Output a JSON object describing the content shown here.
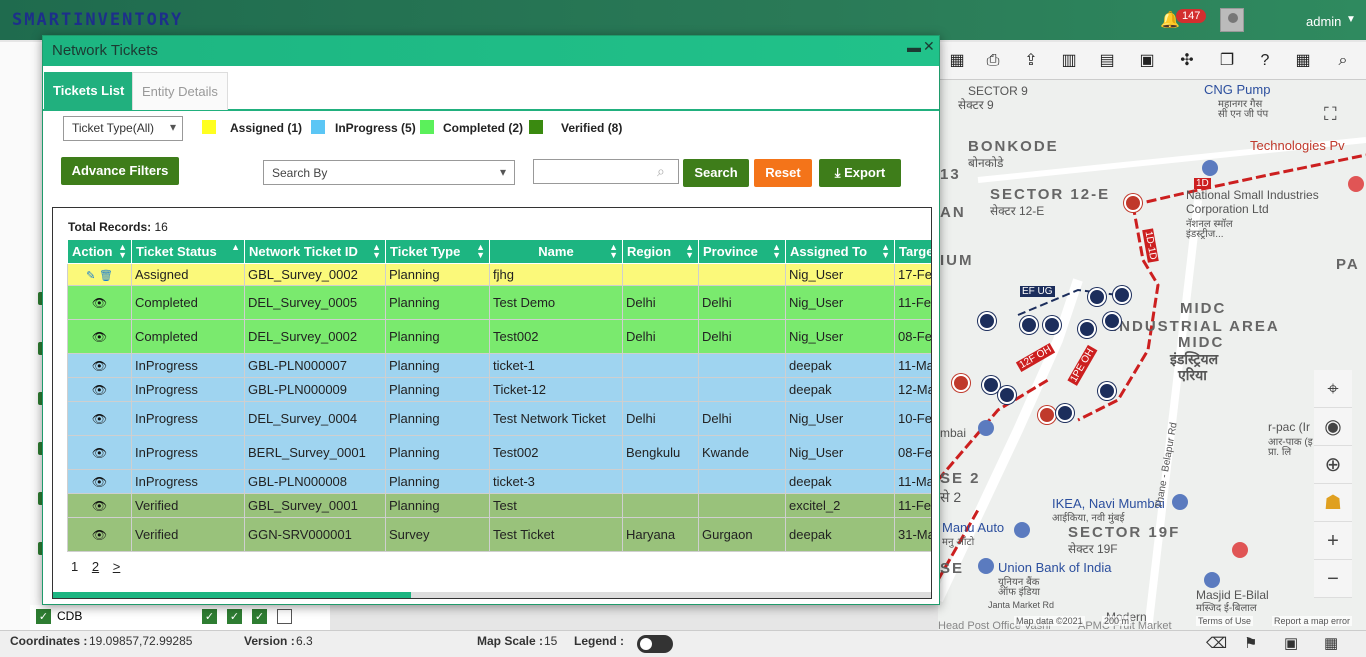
{
  "app": {
    "logo": "SMARTINVENTORY",
    "notifications": "147",
    "user": "admin"
  },
  "map": {
    "labels": [
      "SECTOR 9",
      "सेक्टर 9",
      "CNG Pump",
      "महानगर गैस",
      "सी एन जी पंप",
      "Technologies Pv",
      "BONKODE",
      "बोनकोडे",
      "SECTOR 12-E",
      "सेक्टर 12-E",
      "National Small Industries",
      "Corporation Ltd",
      "नॅशनल स्मॉल",
      "इंडस्ट्रीज...",
      "MIDC",
      "INDUSTRIAL AREA",
      "MIDC",
      "इंडस्ट्रियल",
      "एरिया",
      "IKEA, Navi Mumbai",
      "आईकिया, नवी मुंबई",
      "Manu Auto",
      "मनु ऑटो",
      "SECTOR 19F",
      "सेक्टर 19F",
      "Union Bank of India",
      "यूनियन बैंक",
      "ऑफ इंडिया",
      "Masjid E-Bilal",
      "मस्जिद ई-बिलाल",
      "r-pac (Ir",
      "आर-पाक (इ",
      "प्रा. लि",
      "Thane - Belapur Rd",
      "13",
      "AN",
      "IUM",
      "PA",
      "SE 2",
      "से 2",
      "mbai",
      "Modern",
      "Janta Market Rd",
      "Head Post Office Vashi",
      "APMC Fruit Market",
      "SE",
      "EF UG",
      "1D",
      "1D-1D",
      "12F OH",
      "1PE OH"
    ],
    "attribution": {
      "data": "Map data ©2021",
      "scale": "200 m",
      "terms": "Terms of Use",
      "report": "Report a map error"
    }
  },
  "left_panel": {
    "layer_label": "CDB"
  },
  "status": {
    "coordinates_label": "Coordinates :",
    "coordinates_value": "19.09857,72.99285",
    "version_label": "Version :",
    "version_value": "6.3",
    "scale_label": "Map Scale :",
    "scale_value": "15",
    "legend_label": "Legend :"
  },
  "modal": {
    "title": "Network Tickets",
    "tabs": [
      {
        "label": "Tickets List"
      },
      {
        "label": "Entity Details"
      }
    ],
    "ticket_type": "Ticket Type(All)",
    "status_legend": [
      {
        "label": "Assigned (1)",
        "color": "#ffff20"
      },
      {
        "label": "InProgress (5)",
        "color": "#5bc6f5"
      },
      {
        "label": "Completed (2)",
        "color": "#5bf05b"
      },
      {
        "label": "Verified (8)",
        "color": "#3a8a10"
      }
    ],
    "advance_filters": "Advance Filters",
    "search_by": "Search By",
    "search_input_value": "",
    "search": "Search",
    "reset": "Reset",
    "export": "Export",
    "total_records_label": "Total Records:",
    "total_records_value": "16",
    "columns": [
      "Action",
      "Ticket Status",
      "Network Ticket ID",
      "Ticket Type",
      "Name",
      "Region",
      "Province",
      "Assigned To",
      "Targe"
    ],
    "rows": [
      {
        "status": "Assigned",
        "id": "GBL_Survey_0002",
        "type": "Planning",
        "name": "fjhg",
        "region": "",
        "province": "",
        "assigned": "Nig_User",
        "target": "17-Feb"
      },
      {
        "status": "Completed",
        "id": "DEL_Survey_0005",
        "type": "Planning",
        "name": "Test Demo",
        "region": "Delhi",
        "province": "Delhi",
        "assigned": "Nig_User",
        "target": "11-Feb"
      },
      {
        "status": "Completed",
        "id": "DEL_Survey_0002",
        "type": "Planning",
        "name": "Test002",
        "region": "Delhi",
        "province": "Delhi",
        "assigned": "Nig_User",
        "target": "08-Feb"
      },
      {
        "status": "InProgress",
        "id": "GBL-PLN000007",
        "type": "Planning",
        "name": "ticket-1",
        "region": "",
        "province": "",
        "assigned": "deepak",
        "target": "11-Ma"
      },
      {
        "status": "InProgress",
        "id": "GBL-PLN000009",
        "type": "Planning",
        "name": "Ticket-12",
        "region": "",
        "province": "",
        "assigned": "deepak",
        "target": "12-Ma"
      },
      {
        "status": "InProgress",
        "id": "DEL_Survey_0004",
        "type": "Planning",
        "name": "Test Network Ticket",
        "region": "Delhi",
        "province": "Delhi",
        "assigned": "Nig_User",
        "target": "10-Feb"
      },
      {
        "status": "InProgress",
        "id": "BERL_Survey_0001",
        "type": "Planning",
        "name": "Test002",
        "region": "Bengkulu",
        "province": "Kwande",
        "assigned": "Nig_User",
        "target": "08-Feb"
      },
      {
        "status": "InProgress",
        "id": "GBL-PLN000008",
        "type": "Planning",
        "name": "ticket-3",
        "region": "",
        "province": "",
        "assigned": "deepak",
        "target": "11-Ma"
      },
      {
        "status": "Verified",
        "id": "GBL_Survey_0001",
        "type": "Planning",
        "name": "Test",
        "region": "",
        "province": "",
        "assigned": "excitel_2",
        "target": "11-Feb"
      },
      {
        "status": "Verified",
        "id": "GGN-SRV000001",
        "type": "Survey",
        "name": "Test Ticket",
        "region": "Haryana",
        "province": "Gurgaon",
        "assigned": "deepak",
        "target": "31-Ma"
      }
    ],
    "pager": [
      "1",
      "2",
      ">"
    ]
  }
}
